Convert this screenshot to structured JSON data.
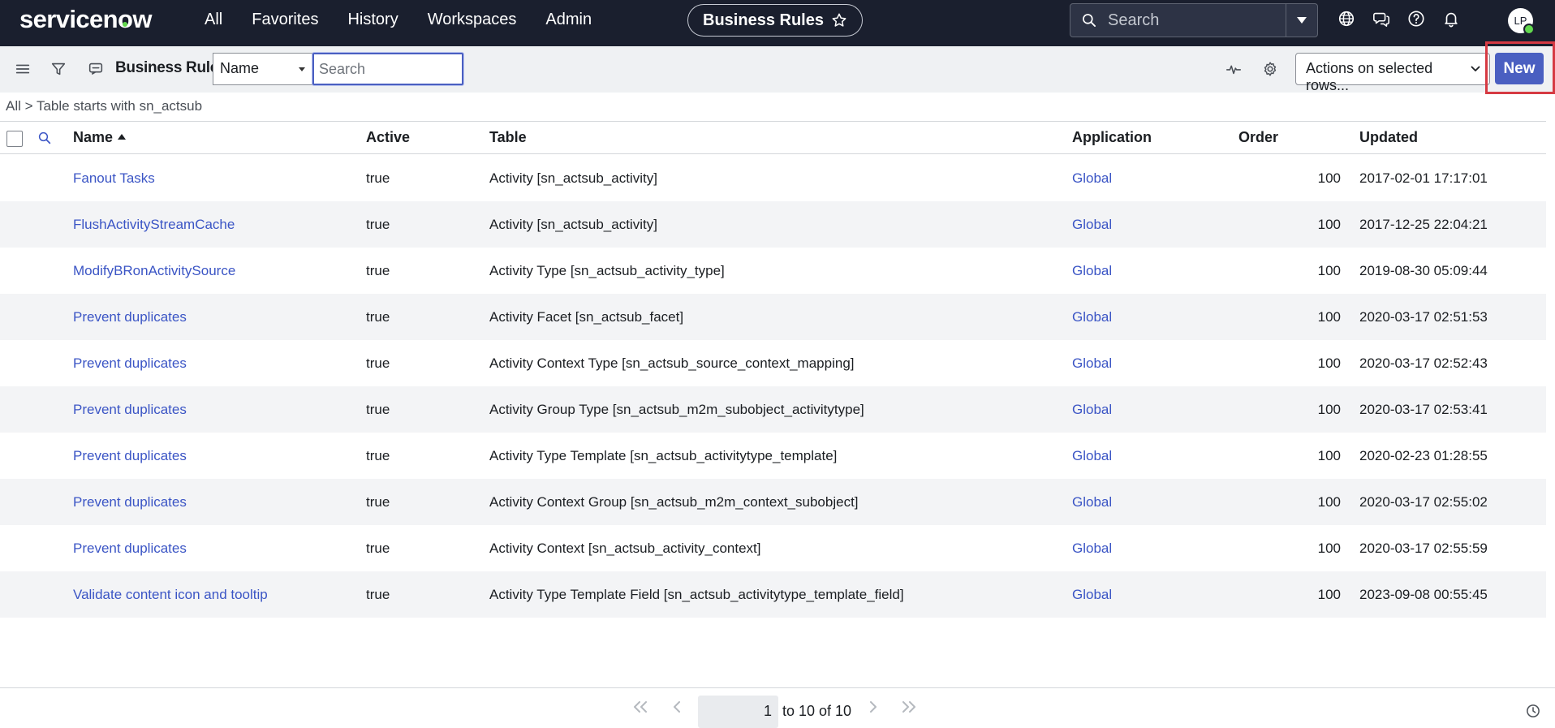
{
  "topnav": {
    "logo": "servicenow",
    "items": [
      "All",
      "Favorites",
      "History",
      "Workspaces",
      "Admin"
    ],
    "context_title": "Business Rules",
    "search_placeholder": "Search",
    "avatar_initials": "LP",
    "icons": [
      "globe-icon",
      "chat-icon",
      "help-icon",
      "bell-icon"
    ]
  },
  "toolbar": {
    "title": "Business Rules",
    "field_select": "Name",
    "search_placeholder": "Search",
    "actions_select": "Actions on selected rows...",
    "new_label": "New"
  },
  "breadcrumb": "All > Table starts with sn_actsub",
  "table": {
    "columns": [
      "Name",
      "Active",
      "Table",
      "Application",
      "Order",
      "Updated"
    ],
    "rows": [
      {
        "name": "Fanout Tasks",
        "active": "true",
        "table": "Activity [sn_actsub_activity]",
        "application": "Global",
        "order": "100",
        "updated": "2017-02-01 17:17:01"
      },
      {
        "name": "FlushActivityStreamCache",
        "active": "true",
        "table": "Activity [sn_actsub_activity]",
        "application": "Global",
        "order": "100",
        "updated": "2017-12-25 22:04:21"
      },
      {
        "name": "ModifyBRonActivitySource",
        "active": "true",
        "table": "Activity Type [sn_actsub_activity_type]",
        "application": "Global",
        "order": "100",
        "updated": "2019-08-30 05:09:44"
      },
      {
        "name": "Prevent duplicates",
        "active": "true",
        "table": "Activity Facet [sn_actsub_facet]",
        "application": "Global",
        "order": "100",
        "updated": "2020-03-17 02:51:53"
      },
      {
        "name": "Prevent duplicates",
        "active": "true",
        "table": "Activity Context Type [sn_actsub_source_context_mapping]",
        "application": "Global",
        "order": "100",
        "updated": "2020-03-17 02:52:43"
      },
      {
        "name": "Prevent duplicates",
        "active": "true",
        "table": "Activity Group Type [sn_actsub_m2m_subobject_activitytype]",
        "application": "Global",
        "order": "100",
        "updated": "2020-03-17 02:53:41"
      },
      {
        "name": "Prevent duplicates",
        "active": "true",
        "table": "Activity Type Template [sn_actsub_activitytype_template]",
        "application": "Global",
        "order": "100",
        "updated": "2020-02-23 01:28:55"
      },
      {
        "name": "Prevent duplicates",
        "active": "true",
        "table": "Activity Context Group [sn_actsub_m2m_context_subobject]",
        "application": "Global",
        "order": "100",
        "updated": "2020-03-17 02:55:02"
      },
      {
        "name": "Prevent duplicates",
        "active": "true",
        "table": "Activity Context [sn_actsub_activity_context]",
        "application": "Global",
        "order": "100",
        "updated": "2020-03-17 02:55:59"
      },
      {
        "name": "Validate content icon and tooltip",
        "active": "true",
        "table": "Activity Type Template Field [sn_actsub_activitytype_template_field]",
        "application": "Global",
        "order": "100",
        "updated": "2023-09-08 00:55:45"
      }
    ]
  },
  "pagination": {
    "current_page": "1",
    "range_text": "to 10 of 10"
  }
}
